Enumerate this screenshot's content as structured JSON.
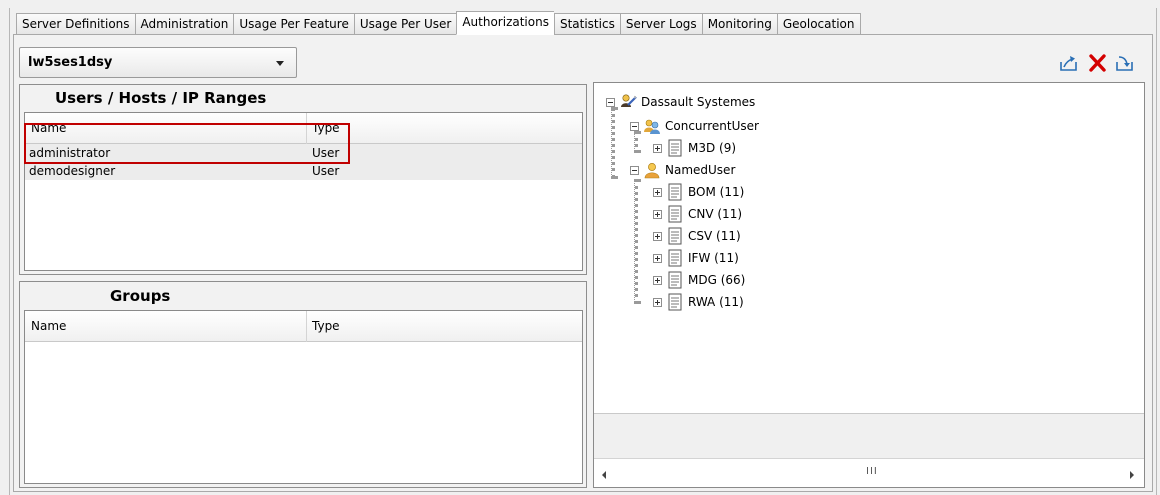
{
  "tabs": [
    {
      "label": "Server Definitions",
      "active": false
    },
    {
      "label": "Administration",
      "active": false
    },
    {
      "label": "Usage Per Feature",
      "active": false
    },
    {
      "label": "Usage Per User",
      "active": false
    },
    {
      "label": "Authorizations",
      "active": true
    },
    {
      "label": "Statistics",
      "active": false
    },
    {
      "label": "Server Logs",
      "active": false
    },
    {
      "label": "Monitoring",
      "active": false
    },
    {
      "label": "Geolocation",
      "active": false
    }
  ],
  "server": {
    "selected": "lw5ses1dsy"
  },
  "toolbar": {
    "icons": [
      "export-icon",
      "delete-icon",
      "import-icon"
    ],
    "delete_color": "#d40000"
  },
  "users_panel": {
    "title": "Users / Hosts / IP Ranges",
    "columns": [
      "Name",
      "Type"
    ],
    "rows": [
      {
        "name": "administrator",
        "type": "User"
      },
      {
        "name": "demodesigner",
        "type": "User"
      }
    ]
  },
  "groups_panel": {
    "title": "Groups",
    "columns": [
      "Name",
      "Type"
    ],
    "rows": []
  },
  "tree": {
    "root": "Dassault Systemes",
    "concurrent": {
      "label": "ConcurrentUser",
      "children": [
        "M3D (9)"
      ]
    },
    "named": {
      "label": "NamedUser",
      "children": [
        "BOM (11)",
        "CNV (11)",
        "CSV (11)",
        "IFW (11)",
        "MDG (66)",
        "RWA (11)"
      ]
    }
  },
  "scrollbar": {
    "grip": "III"
  },
  "colors": {
    "highlight_box": "#c00000",
    "concurrent_icon": "#d9a520",
    "named_icon": "#e8a030"
  }
}
